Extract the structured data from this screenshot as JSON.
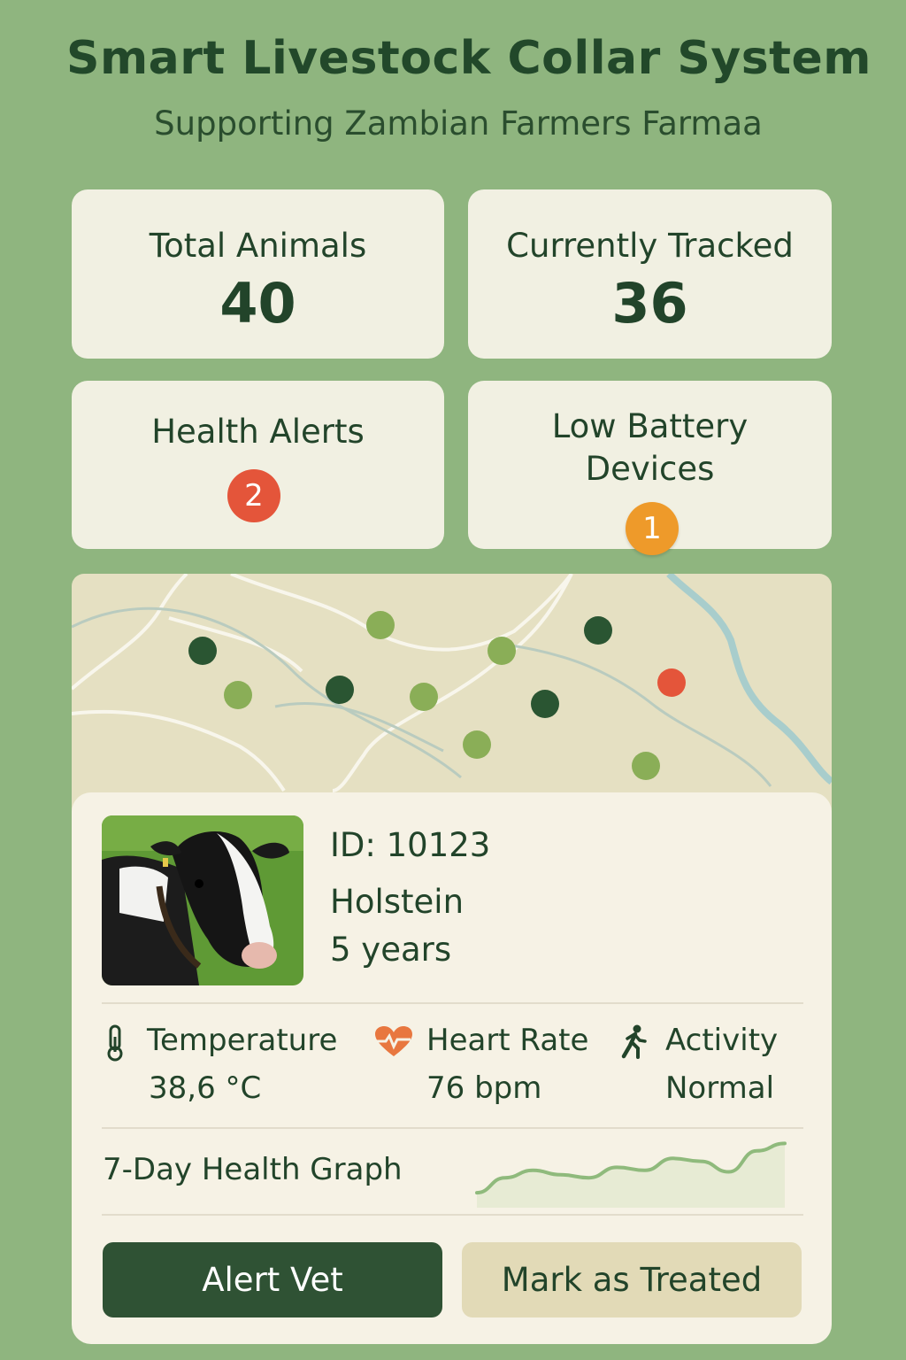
{
  "header": {
    "title": "Smart Livestock Collar System",
    "subtitle": "Supporting Zambian Farmers Farmaa"
  },
  "stats": {
    "total_animals": {
      "label": "Total Animals",
      "value": "40"
    },
    "currently_tracked": {
      "label": "Currently Tracked",
      "value": "36"
    },
    "health_alerts": {
      "label": "Health Alerts",
      "count": "2",
      "color": "#e4553a"
    },
    "low_battery": {
      "label_line1": "Low Battery",
      "label_line2": "Devices",
      "count": "1",
      "color": "#ee9a2a"
    }
  },
  "map": {
    "animal_status_colors": {
      "normal": "#8aae57",
      "tracked": "#2a5532",
      "alert": "#e4553a"
    }
  },
  "animal": {
    "id": "ID: 10123",
    "breed": "Holstein",
    "age": "5 years",
    "photo_icon": "cow-photo"
  },
  "metrics": {
    "temperature": {
      "label": "Temperature",
      "value": "38,6 °C",
      "icon": "thermometer-icon"
    },
    "heart_rate": {
      "label": "Heart Rate",
      "value": "76 bpm",
      "icon": "heart-icon",
      "color": "#e8773f"
    },
    "activity": {
      "label": "Activity",
      "value": "Normal",
      "icon": "running-person-icon"
    }
  },
  "graph": {
    "label": "7-Day Health Graph"
  },
  "chart_data": {
    "type": "area",
    "x": [
      1,
      2,
      3,
      4,
      5,
      6,
      7,
      8,
      9,
      10,
      11,
      12
    ],
    "values": [
      1,
      2,
      2.5,
      2.2,
      2,
      2.7,
      2.5,
      3.3,
      3.1,
      2.4,
      3.8,
      4.3
    ],
    "title": "",
    "xlabel": "",
    "ylabel": "",
    "color": "#8fba7c"
  },
  "actions": {
    "alert_vet": "Alert Vet",
    "mark_treated": "Mark as Treated"
  }
}
